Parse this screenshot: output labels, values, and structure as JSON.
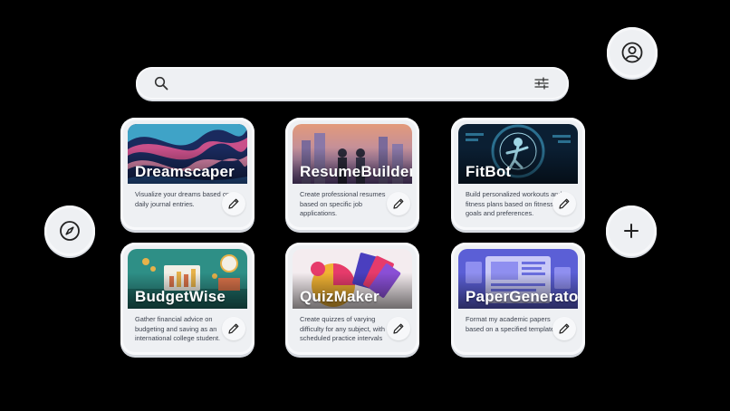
{
  "search": {
    "placeholder": "",
    "search_icon": "search-icon",
    "filter_icon": "sliders-icon"
  },
  "buttons": {
    "profile_icon": "user-icon",
    "explore_icon": "compass-icon",
    "add_icon": "plus-icon"
  },
  "cards": [
    {
      "title": "Dreamscaper",
      "description": "Visualize your dreams based on daily journal entries.",
      "colors": [
        "#1a2a5e",
        "#c9508a",
        "#3fa3c7"
      ]
    },
    {
      "title": "ResumeBuilder",
      "description": "Create professional resumes based on specific job applications.",
      "colors": [
        "#6b4f8f",
        "#e39a7a",
        "#8fb0c9"
      ]
    },
    {
      "title": "FitBot",
      "description": "Build personalized workouts and fitness plans based on fitness goals and preferences.",
      "colors": [
        "#0b1f33",
        "#2b6f8f",
        "#9fd6e6"
      ]
    },
    {
      "title": "BudgetWise",
      "description": "Gather financial advice on budgeting and saving as an international college student.",
      "colors": [
        "#2e8f86",
        "#e7b24a",
        "#d9734a"
      ]
    },
    {
      "title": "QuizMaker",
      "description": "Create quizzes of varying difficulty for any subject, with scheduled practice intervals",
      "colors": [
        "#e63b6b",
        "#f1b233",
        "#4a3fbf"
      ]
    },
    {
      "title": "PaperGenerator",
      "description": "Format my academic papers based on a specified template.",
      "colors": [
        "#5b5fd6",
        "#8f8ff0",
        "#c9c9f7"
      ]
    }
  ]
}
